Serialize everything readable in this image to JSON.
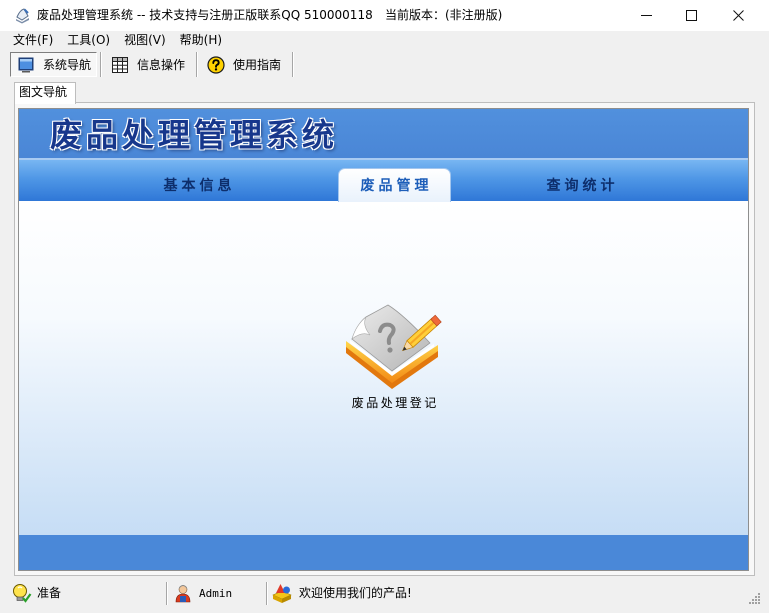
{
  "window": {
    "title": "废品处理管理系统 -- 技术支持与注册正版联系QQ 510000118",
    "version": "当前版本：(非注册版)"
  },
  "menu": {
    "items": [
      {
        "label": "文件(F)"
      },
      {
        "label": "工具(O)"
      },
      {
        "label": "视图(V)"
      },
      {
        "label": "帮助(H)"
      }
    ]
  },
  "toolbar": {
    "buttons": [
      {
        "label": "系统导航",
        "icon": "monitor-icon",
        "checked": true
      },
      {
        "label": "信息操作",
        "icon": "grid-icon",
        "checked": false
      },
      {
        "label": "使用指南",
        "icon": "help-icon",
        "checked": false
      }
    ]
  },
  "tabs": [
    {
      "label": "图文导航",
      "selected": true
    }
  ],
  "navigator": {
    "app_title": "废品处理管理系统",
    "tabs": [
      {
        "label": "基本信息",
        "selected": false
      },
      {
        "label": "废品管理",
        "selected": true
      },
      {
        "label": "查询统计",
        "selected": false
      }
    ],
    "items": [
      {
        "label": "废品处理登记",
        "icon": "book-pencil-icon"
      }
    ]
  },
  "statusbar": {
    "ready": {
      "label": "准备",
      "icon": "lightbulb-icon"
    },
    "user": {
      "label": "Admin",
      "icon": "user-icon"
    },
    "message": {
      "label": "欢迎使用我们的产品!",
      "icon": "shapes-icon"
    }
  },
  "colors": {
    "header_blue": "#4a86d6",
    "nav_light": "#78b6f2",
    "nav_dark": "#2f77d7",
    "footer_blue": "#4a88d8",
    "nav_text": "#0d2e6c",
    "selected_tab_text": "#1d5eb9"
  }
}
